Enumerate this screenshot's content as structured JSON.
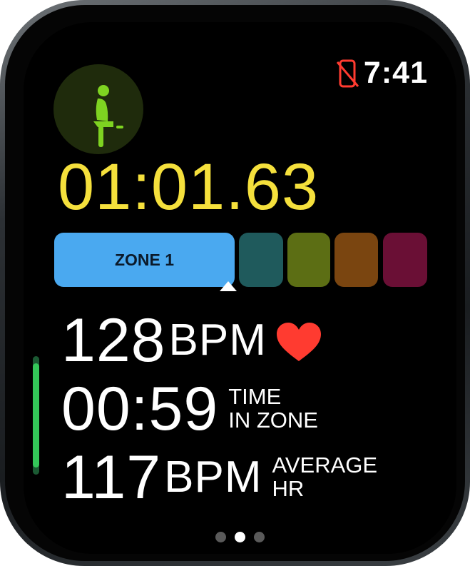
{
  "status_bar": {
    "time": "7:41",
    "phone_disconnected_icon": "phone-slash-icon",
    "icon_color": "#ff3b30"
  },
  "workout": {
    "icon": "indoor-cycle-person-icon",
    "icon_color": "#7ed321",
    "elapsed_time": "01:01.63"
  },
  "heart_rate_zones": {
    "current_zone_label": "ZONE 1",
    "current_zone_index": 1,
    "zones": [
      {
        "zone": 1,
        "color": "#4aa9f0",
        "active": true
      },
      {
        "zone": 2,
        "color": "#1f5a5c",
        "active": false
      },
      {
        "zone": 3,
        "color": "#5c6e14",
        "active": false
      },
      {
        "zone": 4,
        "color": "#7a4510",
        "active": false
      },
      {
        "zone": 5,
        "color": "#6a0f35",
        "active": false
      }
    ]
  },
  "metrics": {
    "heart_rate": {
      "value": "128",
      "unit": "BPM",
      "icon": "heart-icon",
      "icon_color": "#ff3b30"
    },
    "time_in_zone": {
      "value": "00:59",
      "label_line1": "TIME",
      "label_line2": "IN ZONE"
    },
    "average_hr": {
      "value": "117",
      "unit": "BPM",
      "label_line1": "AVERAGE",
      "label_line2": "HR"
    }
  },
  "pagination": {
    "page_count": 3,
    "active_page": 2
  }
}
